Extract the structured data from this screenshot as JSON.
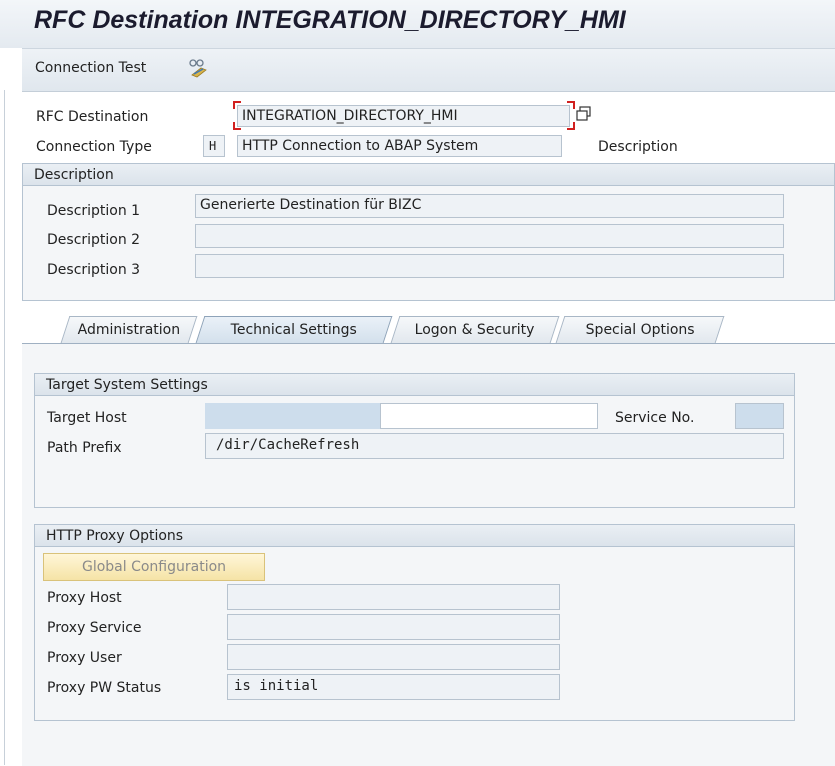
{
  "window": {
    "title": "RFC Destination INTEGRATION_DIRECTORY_HMI"
  },
  "toolbar": {
    "connection_test_label": "Connection Test",
    "connection_test_icon": "glasses-test-icon"
  },
  "header": {
    "rfc_destination_label": "RFC Destination",
    "rfc_destination_value": "INTEGRATION_DIRECTORY_HMI",
    "connection_type_label": "Connection Type",
    "connection_type_code": "H",
    "connection_type_value": "HTTP Connection to ABAP System",
    "description_label": "Description"
  },
  "description_panel": {
    "title": "Description",
    "rows": [
      {
        "label": "Description 1",
        "value": "Generierte Destination für BIZC"
      },
      {
        "label": "Description 2",
        "value": ""
      },
      {
        "label": "Description 3",
        "value": ""
      }
    ]
  },
  "tabs": [
    {
      "label": "Administration",
      "active": false
    },
    {
      "label": "Technical Settings",
      "active": true
    },
    {
      "label": "Logon & Security",
      "active": false
    },
    {
      "label": "Special Options",
      "active": false
    }
  ],
  "target_system": {
    "title": "Target System Settings",
    "target_host_label": "Target Host",
    "target_host_value": "",
    "service_no_label": "Service No.",
    "service_no_value": "",
    "path_prefix_label": "Path Prefix",
    "path_prefix_value": "/dir/CacheRefresh"
  },
  "proxy": {
    "title": "HTTP Proxy Options",
    "global_config_label": "Global Configuration",
    "rows": [
      {
        "label": "Proxy Host",
        "value": ""
      },
      {
        "label": "Proxy Service",
        "value": ""
      },
      {
        "label": "Proxy User",
        "value": ""
      },
      {
        "label": "Proxy PW Status",
        "value": "is initial"
      }
    ]
  },
  "colors": {
    "field_bg": "#eef2f6",
    "field_border": "#b7c3cf",
    "required_marker": "#d1201f",
    "button_bg": "#f5e3a6"
  }
}
